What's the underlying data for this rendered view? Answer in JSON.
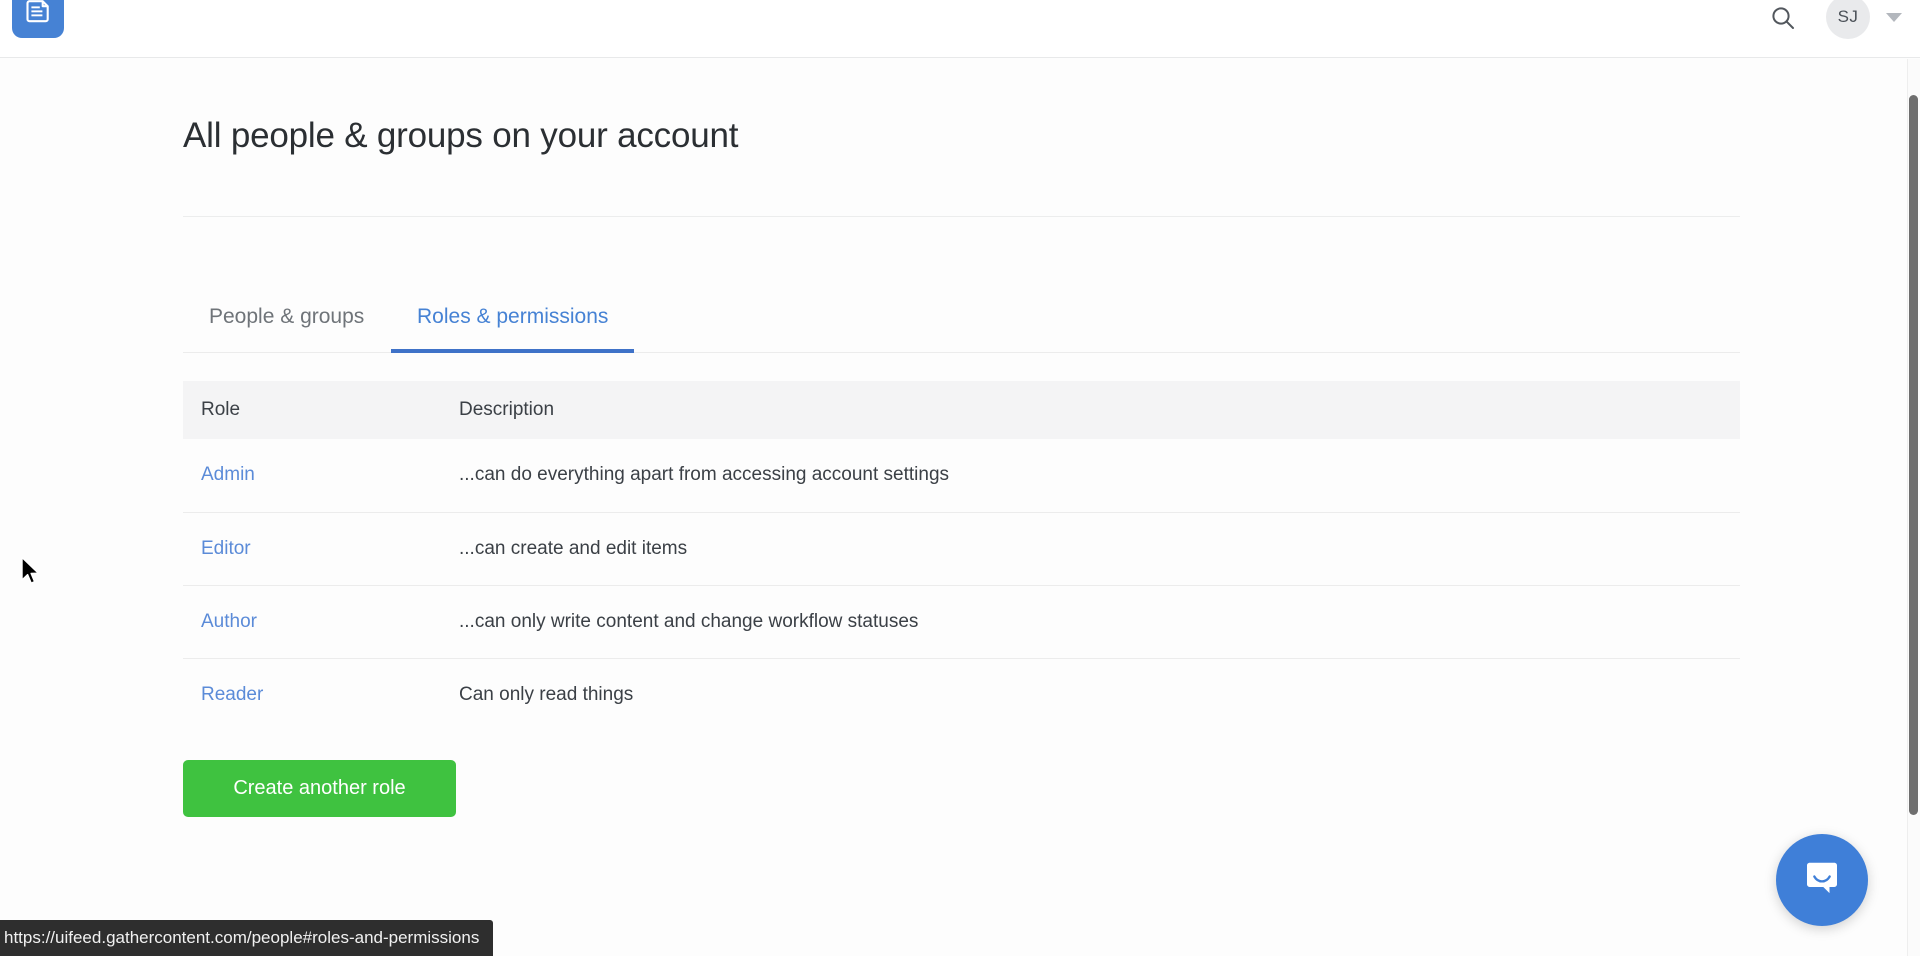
{
  "header": {
    "logo_icon": "document-logo-icon",
    "search_icon": "search-icon",
    "avatar_initials": "SJ",
    "caret_icon": "chevron-down-icon"
  },
  "main": {
    "page_title": "All people & groups on your account",
    "tabs": [
      {
        "label": "People & groups",
        "active": false
      },
      {
        "label": "Roles & permissions",
        "active": true
      }
    ],
    "table": {
      "columns": [
        "Role",
        "Description"
      ],
      "rows": [
        {
          "role": "Admin",
          "description": "...can do everything apart from accessing account settings"
        },
        {
          "role": "Editor",
          "description": "...can create and edit items"
        },
        {
          "role": "Author",
          "description": "...can only write content and change workflow statuses"
        },
        {
          "role": "Reader",
          "description": "Can only read things"
        }
      ]
    },
    "create_button_label": "Create another role"
  },
  "chat": {
    "launcher_icon": "chat-bubble-icon"
  },
  "status_bar": {
    "url": "https://uifeed.gathercontent.com/people#roles-and-permissions"
  },
  "colors": {
    "brand_blue": "#4682d4",
    "link_blue": "#5b8bd8",
    "tab_active_underline": "#3f72c8",
    "create_green": "#3fc240",
    "chat_blue": "#3f7fd8",
    "table_header_bg": "#f4f4f5"
  }
}
